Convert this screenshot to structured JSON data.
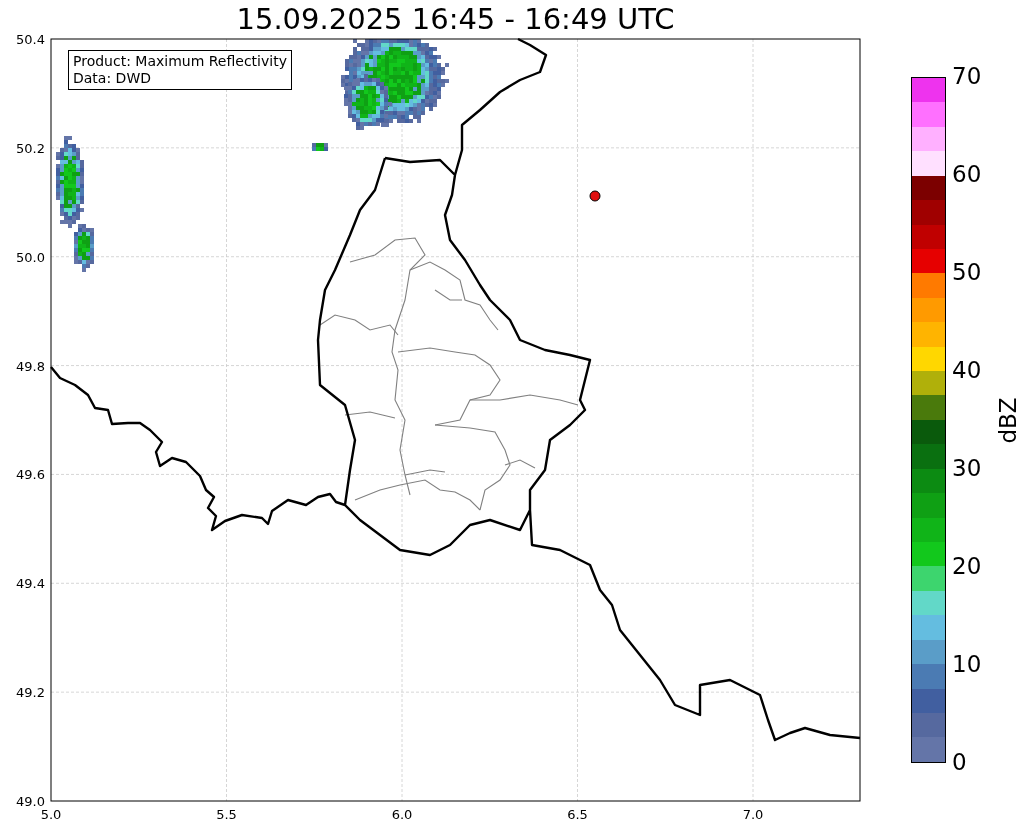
{
  "title": "15.09.2025 16:45 - 16:49 UTC",
  "annotation": {
    "lines": [
      "Product: Maximum Reflectivity",
      "Data: DWD"
    ]
  },
  "map": {
    "xticks": [
      "5.0",
      "5.5",
      "6.0",
      "6.5",
      "7.0"
    ],
    "yticks": [
      "50.4",
      "50.2",
      "50.0",
      "49.8",
      "49.6",
      "49.4",
      "49.2",
      "49.0"
    ]
  },
  "colorbar": {
    "label": "dBZ",
    "ticks": [
      "70",
      "60",
      "50",
      "40",
      "30",
      "20",
      "10",
      "0"
    ],
    "bands": [
      {
        "color": "#ee33ee"
      },
      {
        "color": "#ff70ff"
      },
      {
        "color": "#ffb0ff"
      },
      {
        "color": "#ffe0ff"
      },
      {
        "color": "#7c0000"
      },
      {
        "color": "#a00000"
      },
      {
        "color": "#c00000"
      },
      {
        "color": "#e60000"
      },
      {
        "color": "#ff7a00"
      },
      {
        "color": "#ff9a00"
      },
      {
        "color": "#ffb400"
      },
      {
        "color": "#ffd700"
      },
      {
        "color": "#b0b00a"
      },
      {
        "color": "#4a7a0c"
      },
      {
        "color": "#0a5a0c"
      },
      {
        "color": "#0a7010"
      },
      {
        "color": "#0c8b12"
      },
      {
        "color": "#0fa014"
      },
      {
        "color": "#10b418"
      },
      {
        "color": "#12c81c"
      },
      {
        "color": "#3dd56e"
      },
      {
        "color": "#62d8c8"
      },
      {
        "color": "#64bde0"
      },
      {
        "color": "#5a9dc8"
      },
      {
        "color": "#4b7bb3"
      },
      {
        "color": "#415fa0"
      },
      {
        "color": "#56699f"
      },
      {
        "color": "#6475a8"
      }
    ]
  }
}
